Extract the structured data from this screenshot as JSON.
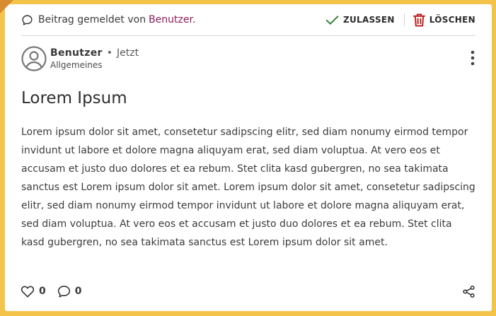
{
  "report": {
    "text": "Beitrag gemeldet von",
    "reporter": "Benutzer.",
    "approve_label": "ZULASSEN",
    "delete_label": "LÖSCHEN"
  },
  "post": {
    "author": "Benutzer",
    "separator": "•",
    "time": "Jetzt",
    "category": "Allgemeines",
    "title": "Lorem Ipsum",
    "body": "Lorem ipsum dolor sit amet, consetetur sadipscing elitr, sed diam nonumy eirmod tempor invidunt ut labore et dolore magna aliquyam erat, sed diam voluptua. At vero eos et accusam et justo duo dolores et ea rebum. Stet clita kasd gubergren, no sea takimata sanctus est Lorem ipsum dolor sit amet. Lorem ipsum dolor sit amet, consetetur sadipscing elitr, sed diam nonumy eirmod tempor invidunt ut labore et dolore magna aliquyam erat, sed diam voluptua. At vero eos et accusam et justo duo dolores et ea rebum. Stet clita kasd gubergren, no sea takimata sanctus est Lorem ipsum dolor sit amet.",
    "likes": "0",
    "comments": "0"
  },
  "icons": {
    "report": "speech-bubble-icon",
    "approve": "checkmark-icon",
    "delete": "trash-icon",
    "avatar": "user-avatar-icon",
    "more": "vertical-dots-icon",
    "like": "heart-icon",
    "comment": "comment-icon",
    "share": "share-icon"
  },
  "colors": {
    "background": "#f3c34a",
    "corner": "#d88b2f",
    "reporter_link": "#8b1a5a",
    "approve": "#2e7d32",
    "delete": "#b71c1c"
  }
}
